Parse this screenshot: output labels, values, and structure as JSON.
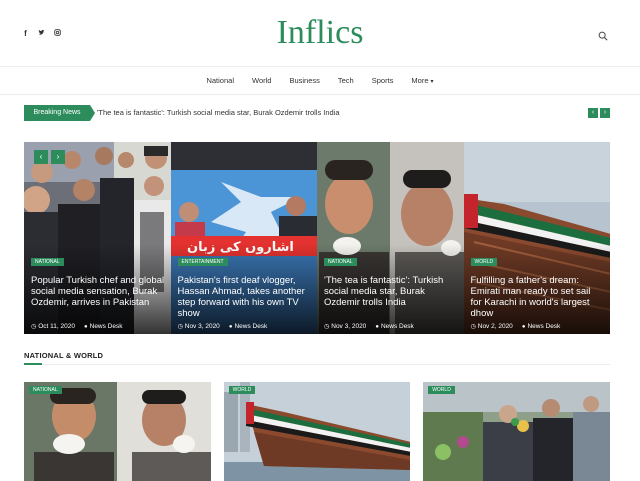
{
  "header": {
    "logo": "Inflics",
    "social_icons": [
      "facebook-icon",
      "twitter-icon",
      "instagram-icon"
    ],
    "social_glyphs": [
      "f",
      "t",
      "◎"
    ]
  },
  "nav": {
    "items": [
      "National",
      "World",
      "Business",
      "Tech",
      "Sports",
      "More"
    ],
    "more_caret": "▾"
  },
  "breaking": {
    "label": "Breaking News",
    "text": "'The tea is fantastic': Turkish social media star, Burak Ozdemir trolls India",
    "prev": "‹",
    "next": "›"
  },
  "slider": {
    "prev": "‹",
    "next": "›",
    "slides": [
      {
        "category": "NATIONAL",
        "title": "Popular Turkish chef and global social media sensation, Burak Ozdemir, arrives in Pakistan",
        "date": "Oct 11, 2020",
        "author": "News Desk"
      },
      {
        "category": "ENTERTAINMENT",
        "title": "Pakistan's first deaf vlogger, Hassan Ahmad, takes another step forward with his own TV show",
        "date": "Nov 3, 2020",
        "author": "News Desk"
      },
      {
        "category": "NATIONAL",
        "title": "'The tea is fantastic': Turkish social media star, Burak Ozdemir trolls India",
        "date": "Nov 3, 2020",
        "author": "News Desk"
      },
      {
        "category": "WORLD",
        "title": "Fulfilling a father's dream: Emirati man ready to set sail for Karachi in world's largest dhow",
        "date": "Nov 2, 2020",
        "author": "News Desk"
      }
    ]
  },
  "section": {
    "title": "NATIONAL & WORLD",
    "cards": [
      {
        "category": "NATIONAL"
      },
      {
        "category": "WORLD"
      },
      {
        "category": "WORLD"
      }
    ]
  },
  "colors": {
    "accent": "#2c8c5c"
  }
}
